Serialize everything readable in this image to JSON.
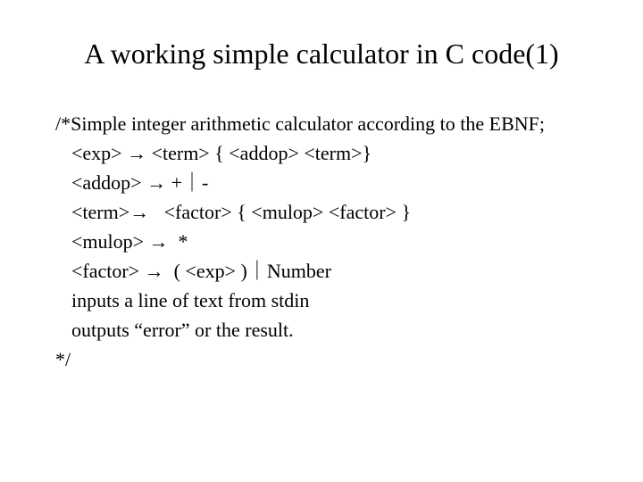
{
  "title": "A working simple calculator in C code(1)",
  "lines": {
    "l0": "/*Simple integer arithmetic calculator according to the EBNF;",
    "l1": "<exp> → <term> { <addop> <term>}",
    "l2": "<addop> → +｜-",
    "l3": "<term>→   <factor> { <mulop> <factor> }",
    "l4": "<mulop> →  *",
    "l5": "<factor> →  ( <exp> )｜Number",
    "l6": "inputs a line of text from stdin",
    "l7": "outputs “error” or the result.",
    "l8": "*/"
  }
}
